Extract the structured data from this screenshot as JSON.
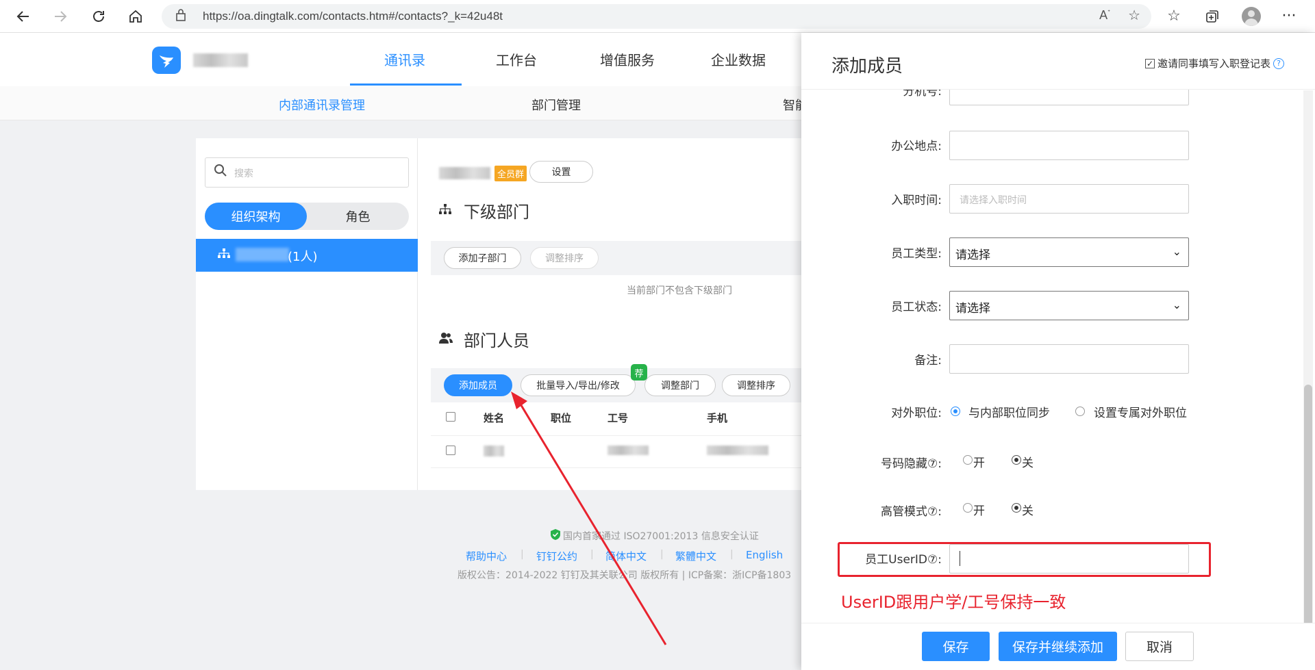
{
  "browser": {
    "url": "https://oa.dingtalk.com/contacts.htm#/contacts?_k=42u48t"
  },
  "app": {
    "nav_tabs": [
      "通讯录",
      "工作台",
      "增值服务",
      "企业数据"
    ],
    "sub_tabs": [
      "内部通讯录管理",
      "部门管理",
      "智能"
    ]
  },
  "left": {
    "search_placeholder": "搜索",
    "seg_org": "组织架构",
    "seg_role": "角色",
    "dept_count": "(1人)"
  },
  "dept": {
    "all_member_tag": "全员群",
    "settings_btn": "设置",
    "sub_dept_title": "下级部门",
    "add_sub_dept_btn": "添加子部门",
    "sort_btn": "调整排序",
    "empty_text": "当前部门不包含下级部门",
    "members_title": "部门人员",
    "add_member_btn": "添加成员",
    "batch_btn": "批量导入/导出/修改",
    "rec_badge": "荐",
    "adjust_dept_btn": "调整部门",
    "adjust_sort_btn": "调整排序",
    "columns": [
      "姓名",
      "职位",
      "工号",
      "手机"
    ]
  },
  "footer": {
    "cert": "国内首家通过 ISO27001:2013 信息安全认证",
    "links": [
      "帮助中心",
      "钉钉公约",
      "简体中文",
      "繁體中文",
      "English"
    ],
    "copyright": "版权公告：2014-2022 钉钉及其关联公司 版权所有 | ICP备案：浙ICP备1803"
  },
  "panel": {
    "title": "添加成员",
    "invite_label": "邀请同事填写入职登记表",
    "partial_label": "分机号:",
    "office_label": "办公地点:",
    "hire_label": "入职时间:",
    "hire_placeholder": "请选择入职时间",
    "type_label": "员工类型:",
    "type_value": "请选择",
    "status_label": "员工状态:",
    "status_value": "请选择",
    "remark_label": "备注:",
    "ext_pos_label": "对外职位:",
    "ext_pos_opt1": "与内部职位同步",
    "ext_pos_opt2": "设置专属对外职位",
    "hide_label": "号码隐藏⑦:",
    "exec_label": "高管模式⑦:",
    "on": "开",
    "off": "关",
    "userid_label": "员工UserID⑦:",
    "annotation": "UserID跟用户学/工号保持一致",
    "save_btn": "保存",
    "save_continue_btn": "保存并继续添加",
    "cancel_btn": "取消"
  },
  "colors": {
    "primary": "#2a8fff",
    "annotation_red": "#e8232e",
    "tag_orange": "#f5a623",
    "badge_green": "#27b24a"
  }
}
